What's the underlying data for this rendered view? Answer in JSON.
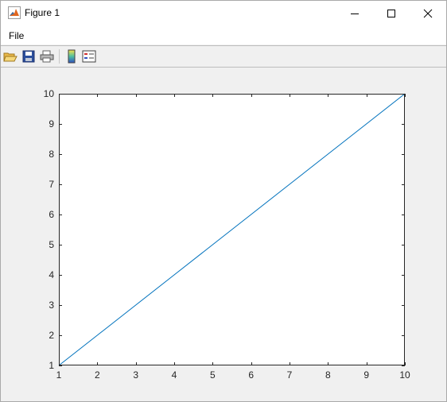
{
  "window": {
    "title": "Figure 1"
  },
  "menu": {
    "file_label": "File"
  },
  "toolbar": {
    "icons": [
      "open-file-icon",
      "save-icon",
      "print-icon",
      "colorbar-icon",
      "legend-icon"
    ]
  },
  "colors": {
    "line": "#0072bd",
    "axes_bg": "#ffffff",
    "figure_bg": "#f0f0f0",
    "axis_color": "#262626"
  },
  "chart_data": {
    "type": "line",
    "title": "",
    "xlabel": "",
    "ylabel": "",
    "xlim": [
      1,
      10
    ],
    "ylim": [
      1,
      10
    ],
    "x_ticks": [
      "1",
      "2",
      "3",
      "4",
      "5",
      "6",
      "7",
      "8",
      "9",
      "10"
    ],
    "y_ticks": [
      "1",
      "2",
      "3",
      "4",
      "5",
      "6",
      "7",
      "8",
      "9",
      "10"
    ],
    "grid": false,
    "series": [
      {
        "x": [
          1,
          2,
          3,
          4,
          5,
          6,
          7,
          8,
          9,
          10
        ],
        "y": [
          1,
          2,
          3,
          4,
          5,
          6,
          7,
          8,
          9,
          10
        ],
        "color": "#0072bd"
      }
    ]
  }
}
